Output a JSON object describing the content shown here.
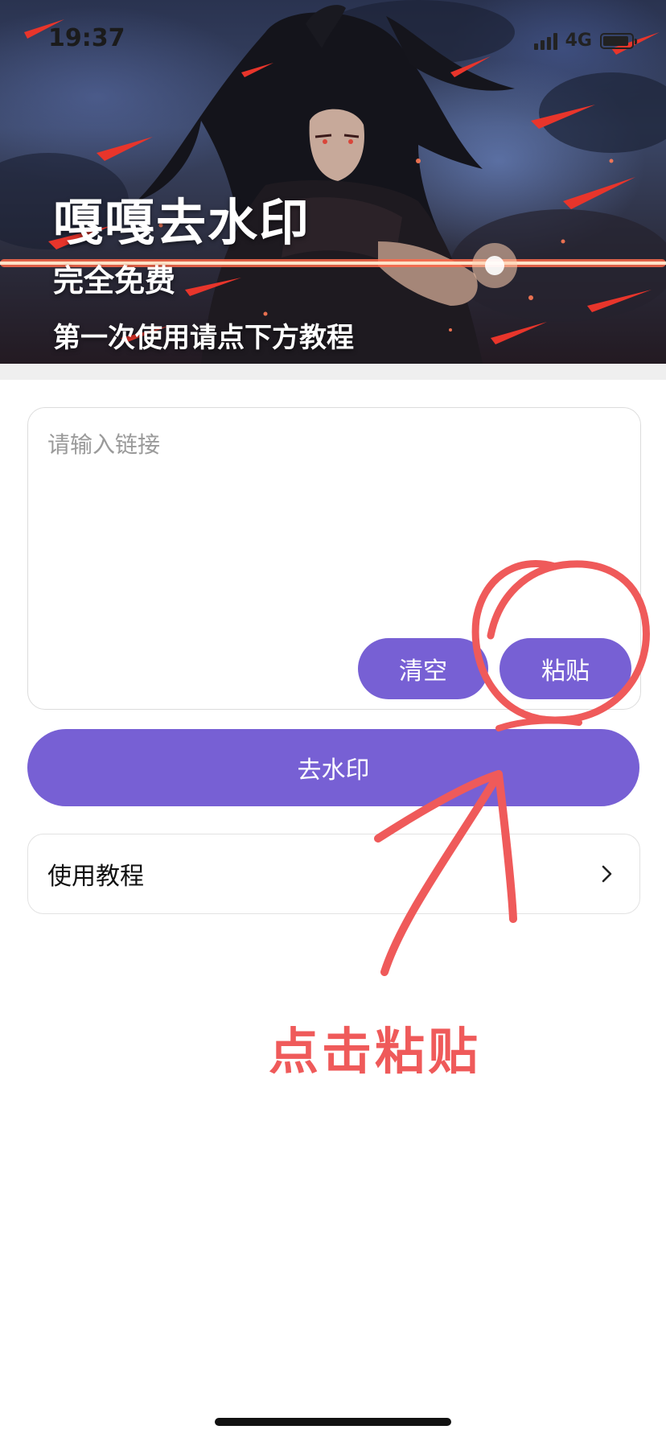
{
  "status_bar": {
    "time": "19:37",
    "network": "4G",
    "battery_level": 0.9
  },
  "hero": {
    "title": "嘎嘎去水印",
    "subtitle": "完全免费",
    "hint": "第一次使用请点下方教程"
  },
  "input": {
    "placeholder": "请输入链接",
    "value": "",
    "clear_label": "清空",
    "paste_label": "粘贴"
  },
  "main_action": {
    "label": "去水印"
  },
  "tutorial": {
    "label": "使用教程",
    "icon": "chevron-right-icon"
  },
  "annotation": {
    "text": "点击粘贴",
    "color": "#ef5a5a"
  },
  "colors": {
    "accent": "#7760d4",
    "annotation": "#ef5a5a"
  }
}
